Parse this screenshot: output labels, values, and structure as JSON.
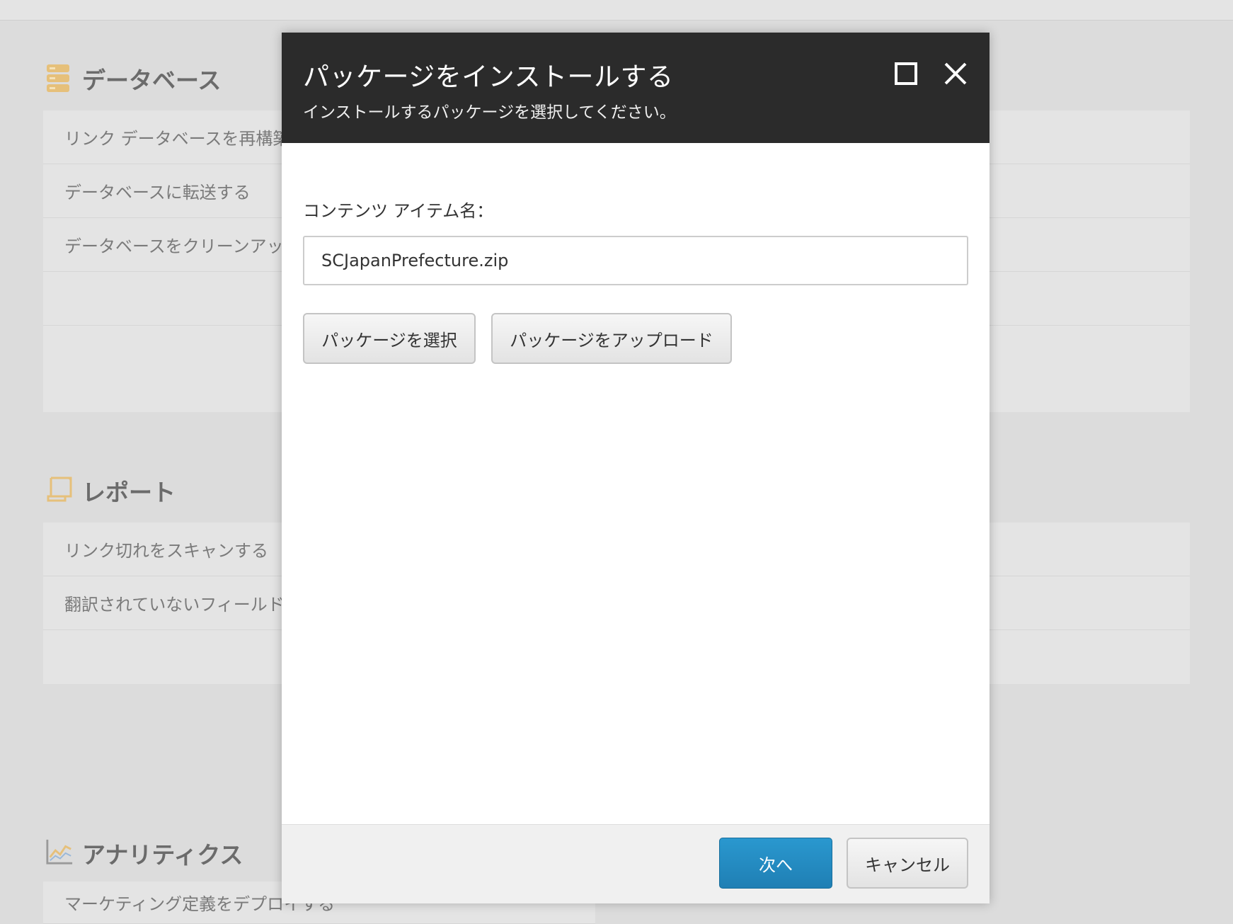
{
  "background": {
    "sections": [
      {
        "title": "データベース",
        "icon": "database-icon",
        "items": [
          "リンク データベースを再構築",
          "データベースに転送する",
          "データベースをクリーンアップ"
        ]
      },
      {
        "title": "レポート",
        "icon": "report-scroll-icon",
        "items": [
          "リンク切れをスキャンする",
          "翻訳されていないフィールド"
        ]
      },
      {
        "title": "アナリティクス",
        "icon": "analytics-chart-icon",
        "items": [
          "マーケティング定義をデプロイする"
        ]
      }
    ]
  },
  "dialog": {
    "title": "パッケージをインストールする",
    "subtitle": "インストールするパッケージを選択してください。",
    "maximize_icon": "maximize-icon",
    "close_icon": "close-icon",
    "field_label": "コンテンツ アイテム名：",
    "field_value": "SCJapanPrefecture.zip",
    "select_package_label": "パッケージを選択",
    "upload_package_label": "パッケージをアップロード",
    "next_label": "次へ",
    "cancel_label": "キャンセル"
  },
  "colors": {
    "header_bg": "#2b2b2b",
    "primary_button": "#1f7fb4",
    "icon_accent": "#e6c07a"
  }
}
